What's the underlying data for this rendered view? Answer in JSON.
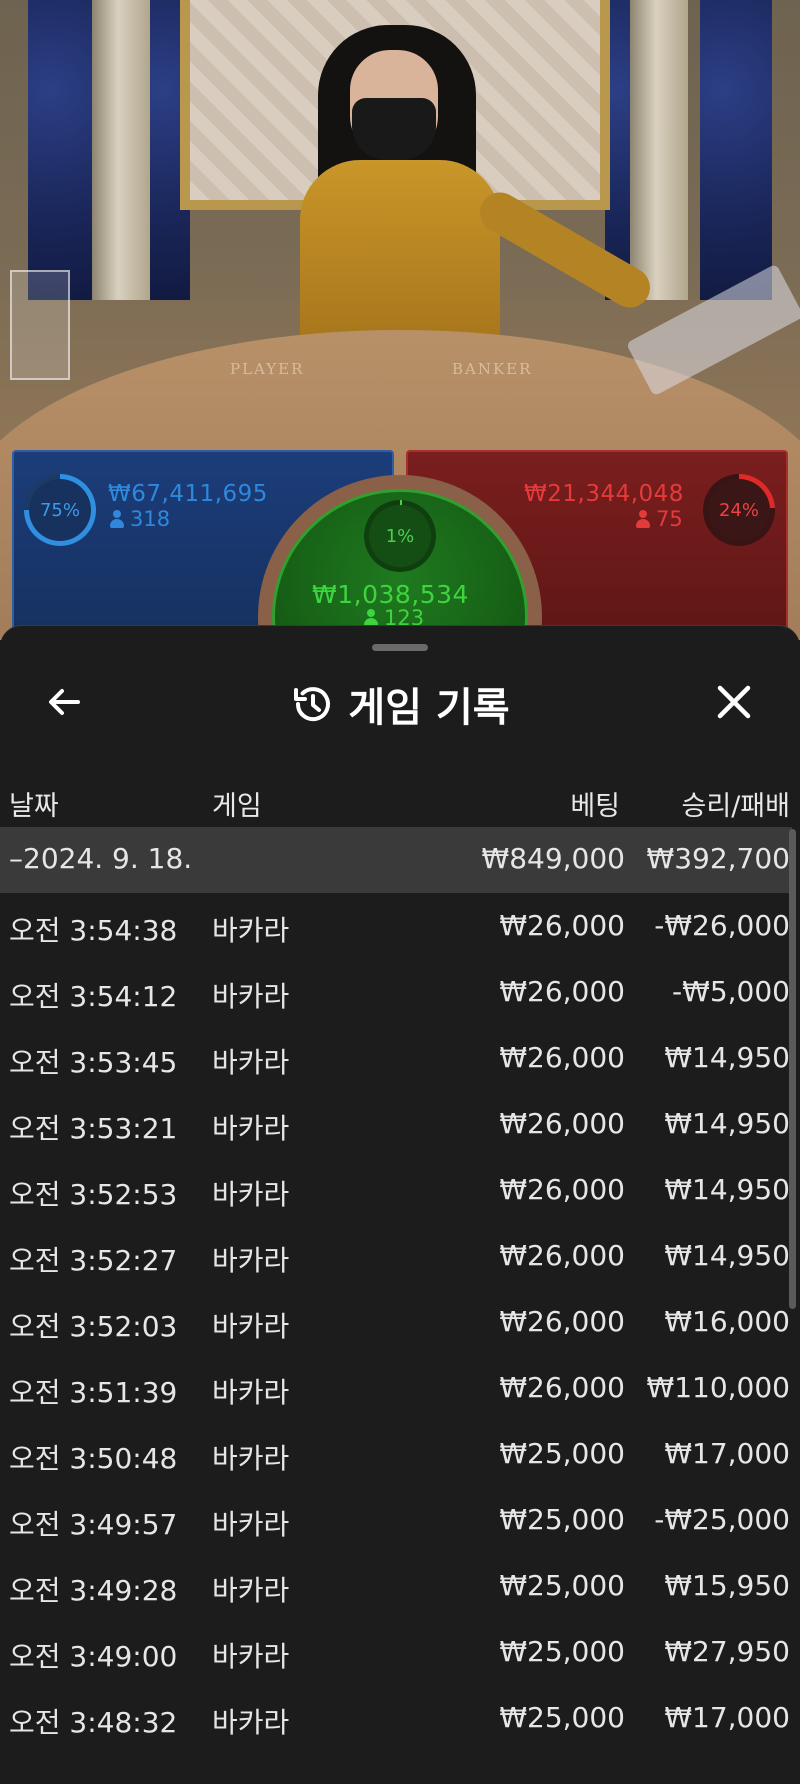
{
  "bet_panels": {
    "player": {
      "percent": "75%",
      "amount": "₩67,411,695",
      "players": "318",
      "color": "#2f88dc"
    },
    "banker": {
      "percent": "24%",
      "amount": "₩21,344,048",
      "players": "75",
      "color": "#e43a3a"
    },
    "tie": {
      "percent": "1%",
      "amount": "₩1,038,534",
      "players": "123",
      "color": "#3fd43f"
    },
    "table_labels": {
      "player": "PLAYER",
      "banker": "BANKER"
    }
  },
  "history": {
    "title": "게임 기록",
    "columns": {
      "date": "날짜",
      "game": "게임",
      "bet": "베팅",
      "result": "승리/패배"
    },
    "summary": {
      "date": "–2024. 9. 18.",
      "bet": "₩849,000",
      "result": "₩392,700"
    },
    "rows": [
      {
        "time": "오전 3:54:38",
        "game": "바카라",
        "bet": "₩26,000",
        "result": "-₩26,000"
      },
      {
        "time": "오전 3:54:12",
        "game": "바카라",
        "bet": "₩26,000",
        "result": "-₩5,000"
      },
      {
        "time": "오전 3:53:45",
        "game": "바카라",
        "bet": "₩26,000",
        "result": "₩14,950"
      },
      {
        "time": "오전 3:53:21",
        "game": "바카라",
        "bet": "₩26,000",
        "result": "₩14,950"
      },
      {
        "time": "오전 3:52:53",
        "game": "바카라",
        "bet": "₩26,000",
        "result": "₩14,950"
      },
      {
        "time": "오전 3:52:27",
        "game": "바카라",
        "bet": "₩26,000",
        "result": "₩14,950"
      },
      {
        "time": "오전 3:52:03",
        "game": "바카라",
        "bet": "₩26,000",
        "result": "₩16,000"
      },
      {
        "time": "오전 3:51:39",
        "game": "바카라",
        "bet": "₩26,000",
        "result": "₩110,000"
      },
      {
        "time": "오전 3:50:48",
        "game": "바카라",
        "bet": "₩25,000",
        "result": "₩17,000"
      },
      {
        "time": "오전 3:49:57",
        "game": "바카라",
        "bet": "₩25,000",
        "result": "-₩25,000"
      },
      {
        "time": "오전 3:49:28",
        "game": "바카라",
        "bet": "₩25,000",
        "result": "₩15,950"
      },
      {
        "time": "오전 3:49:00",
        "game": "바카라",
        "bet": "₩25,000",
        "result": "₩27,950"
      },
      {
        "time": "오전 3:48:32",
        "game": "바카라",
        "bet": "₩25,000",
        "result": "₩17,000"
      }
    ]
  },
  "icons": {
    "back": "arrow-left-icon",
    "history": "history-clock-icon",
    "close": "close-icon"
  }
}
